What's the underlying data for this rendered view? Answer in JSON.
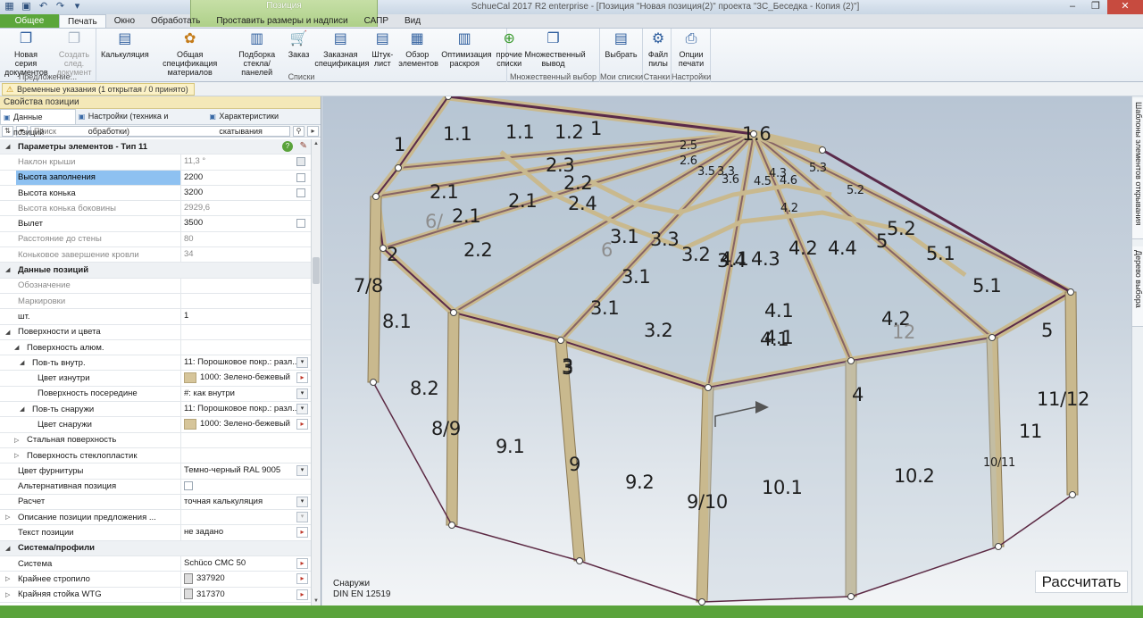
{
  "window": {
    "title": "SchueCal 2017 R2 enterprise - [Позиция \"Новая позиция(2)\" проекта \"3С_Беседка - Копия (2)\"]",
    "context_tab": "Позиция",
    "controls": [
      "–",
      "❐",
      "✕"
    ]
  },
  "tabs": [
    {
      "label": "Общее"
    },
    {
      "label": "Печать"
    },
    {
      "label": "Окно"
    },
    {
      "label": "Обработать"
    },
    {
      "label": "Проставить размеры и надписи"
    },
    {
      "label": "САПР"
    },
    {
      "label": "Вид"
    }
  ],
  "ribbon": {
    "groups": [
      {
        "caption": "Предложение...",
        "buttons": [
          {
            "label": "Новая серия документов",
            "icon": "document-stack-icon"
          },
          {
            "label": "Создать след. документ",
            "icon": "document-next-icon"
          }
        ]
      },
      {
        "caption": "Списки",
        "buttons": [
          {
            "label": "Калькуляция",
            "icon": "calculation-icon"
          },
          {
            "label": "Общая спецификация материалов",
            "icon": "materials-icon"
          },
          {
            "label": "Подборка стекла/панелей",
            "icon": "glass-panels-icon"
          },
          {
            "label": "Заказ",
            "icon": "cart-icon"
          },
          {
            "label": "Заказная спецификация",
            "icon": "order-spec-icon"
          },
          {
            "label": "Штук-лист",
            "icon": "piece-list-icon"
          },
          {
            "label": "Обзор элементов",
            "icon": "elements-overview-icon"
          },
          {
            "label": "Оптимизация раскроя",
            "icon": "cut-optimization-icon"
          },
          {
            "label": "прочие списки",
            "icon": "other-lists-icon"
          }
        ]
      },
      {
        "caption": "Множественный выбор",
        "buttons": [
          {
            "label": "Множественный вывод",
            "icon": "multi-output-icon"
          }
        ]
      },
      {
        "caption": "Мои списки",
        "buttons": [
          {
            "label": "Выбрать",
            "icon": "choose-icon"
          }
        ]
      },
      {
        "caption": "Станки",
        "buttons": [
          {
            "label": "Файл пилы",
            "icon": "saw-file-icon"
          }
        ]
      },
      {
        "caption": "Настройки",
        "buttons": [
          {
            "label": "Опции печати",
            "icon": "print-options-icon"
          }
        ]
      }
    ]
  },
  "hint": "Временные указания (1 открытая / 0 принято)",
  "left_panel": {
    "title": "Свойства позиции",
    "tabs": [
      "Данные позиций",
      "Настройки (техника и обработки)",
      "Характеристики скатывания"
    ],
    "search_placeholder": "Поиск",
    "rows": [
      {
        "type": "cat",
        "label": "Параметры элементов - Тип 11",
        "expander": "◢"
      },
      {
        "type": "prop",
        "dim": true,
        "label": "Наклон крыши",
        "value": "11,3 °",
        "check": "dis"
      },
      {
        "type": "prop",
        "sel": true,
        "label": "Высота заполнения",
        "value": "2200",
        "check": "on"
      },
      {
        "type": "prop",
        "label": "Высота конька",
        "value": "3200",
        "check": "on"
      },
      {
        "type": "prop",
        "dim": true,
        "label": "Высота конька боковины",
        "value": "2929,6"
      },
      {
        "type": "prop",
        "label": "Вылет",
        "value": "3500",
        "check": "on"
      },
      {
        "type": "prop",
        "dim": true,
        "label": "Расстояние до стены",
        "value": "80"
      },
      {
        "type": "prop",
        "dim": true,
        "label": "Коньковое завершение кровли",
        "value": "34"
      },
      {
        "type": "cat",
        "label": "Данные позиций",
        "expander": "◢"
      },
      {
        "type": "prop",
        "dim": true,
        "label": "Обозначение",
        "value": ""
      },
      {
        "type": "prop",
        "dim": true,
        "label": "Маркировки",
        "value": ""
      },
      {
        "type": "prop",
        "label": "шт.",
        "value": "1"
      },
      {
        "type": "prop",
        "label": "Поверхности и цвета",
        "value": "",
        "expander": "◢",
        "indent": 0
      },
      {
        "type": "prop",
        "label": "Поверхность алюм.",
        "value": "",
        "expander": "◢",
        "indent": 1
      },
      {
        "type": "prop",
        "label": "Пов-ть внутр.",
        "value": "11: Порошковое покр.: разл...",
        "expander": "◢",
        "indent": 2,
        "control": "dd"
      },
      {
        "type": "prop",
        "label": "Цвет изнутри",
        "value": "1000: Зелено-бежевый",
        "indent": 3,
        "swatch": true,
        "control": "pk"
      },
      {
        "type": "prop",
        "label": "Поверхность посередине",
        "value": "#: как внутри",
        "indent": 3,
        "control": "dd"
      },
      {
        "type": "prop",
        "label": "Пов-ть снаружи",
        "value": "11: Порошковое покр.: разл...",
        "expander": "◢",
        "indent": 2,
        "control": "dd"
      },
      {
        "type": "prop",
        "label": "Цвет снаружи",
        "value": "1000: Зелено-бежевый",
        "indent": 3,
        "swatch": true,
        "control": "pk"
      },
      {
        "type": "prop",
        "label": "Стальная поверхность",
        "value": "",
        "expander": "▷",
        "indent": 1
      },
      {
        "type": "prop",
        "label": "Поверхность стеклопластик",
        "value": "",
        "expander": "▷",
        "indent": 1
      },
      {
        "type": "prop",
        "label": "Цвет фурнитуры",
        "value": "Темно-черный RAL 9005",
        "control": "dd"
      },
      {
        "type": "prop",
        "label": "Альтернативная позиция",
        "value": "",
        "check": "inline"
      },
      {
        "type": "prop",
        "label": "Расчет",
        "value": "точная калькуляция",
        "control": "dd"
      },
      {
        "type": "prop",
        "label": "Описание позиции предложения ...",
        "value": "",
        "expander": "▷",
        "control": "ddg"
      },
      {
        "type": "prop",
        "label": "Текст позиции",
        "value": "не задано",
        "control": "pk"
      },
      {
        "type": "cat",
        "label": "Система/профили",
        "expander": "◢"
      },
      {
        "type": "prop",
        "label": "Система",
        "value": "Schüco CMC 50",
        "control": "pk"
      },
      {
        "type": "prop",
        "label": "Крайнее стропило",
        "value": "337920",
        "expander": "▷",
        "icon": true,
        "control": "pk"
      },
      {
        "type": "prop",
        "label": "Крайняя стойка WTG",
        "value": "317370",
        "expander": "▷",
        "icon": true,
        "control": "pk"
      }
    ]
  },
  "viewport": {
    "caption_line1": "Снаружи",
    "caption_line2": "DIN EN 12519",
    "calc_button": "Рассчитать",
    "labels": [
      {
        "t": "1.1"
      },
      {
        "t": "1.1"
      },
      {
        "t": "1.2"
      },
      {
        "t": "1"
      },
      {
        "t": "1"
      },
      {
        "t": "1.6"
      },
      {
        "t": "2.1"
      },
      {
        "t": "2.3"
      },
      {
        "t": "2.2"
      },
      {
        "t": "2.4"
      },
      {
        "t": "2.1"
      },
      {
        "t": "2.1"
      },
      {
        "t": "2.2"
      },
      {
        "t": "6/"
      },
      {
        "t": "2"
      },
      {
        "t": "6"
      },
      {
        "t": "3.1"
      },
      {
        "t": "3.3"
      },
      {
        "t": "3.2"
      },
      {
        "t": "3.4"
      },
      {
        "t": "3.1"
      },
      {
        "t": "3.1"
      },
      {
        "t": "3.2"
      },
      {
        "t": "3"
      },
      {
        "t": "4.1"
      },
      {
        "t": "4.3"
      },
      {
        "t": "4.2"
      },
      {
        "t": "4.4"
      },
      {
        "t": "4.1"
      },
      {
        "t": "4.1"
      },
      {
        "t": "4.1"
      },
      {
        "t": "4.2"
      },
      {
        "t": "12"
      },
      {
        "t": "4"
      },
      {
        "t": "5"
      },
      {
        "t": "5.2"
      },
      {
        "t": "5.1"
      },
      {
        "t": "5.1"
      },
      {
        "t": "5"
      },
      {
        "t": "7/8"
      },
      {
        "t": "8.1"
      },
      {
        "t": "8.2"
      },
      {
        "t": "8/9"
      },
      {
        "t": "9.1"
      },
      {
        "t": "9"
      },
      {
        "t": "9.2"
      },
      {
        "t": "9/10"
      },
      {
        "t": "10.1"
      },
      {
        "t": "10.2"
      },
      {
        "t": "10/11"
      },
      {
        "t": "11/12"
      },
      {
        "t": "11"
      },
      {
        "t": "2.5"
      },
      {
        "t": "2.6"
      },
      {
        "t": "3.5"
      },
      {
        "t": "3.3"
      },
      {
        "t": "3.6"
      },
      {
        "t": "4.5"
      },
      {
        "t": "4.3"
      },
      {
        "t": "4.6"
      },
      {
        "t": "5.3"
      },
      {
        "t": "5.2"
      },
      {
        "t": "4.2"
      },
      {
        "t": "3"
      }
    ]
  },
  "right_strip": [
    "Шаблоны элементов открывания",
    "Дерево выбора"
  ],
  "colors": {
    "accent_green": "#5aa33b",
    "frame": "#c9b98e",
    "glass": "#b7c6d3",
    "profile_dark": "#5a2a4a"
  }
}
